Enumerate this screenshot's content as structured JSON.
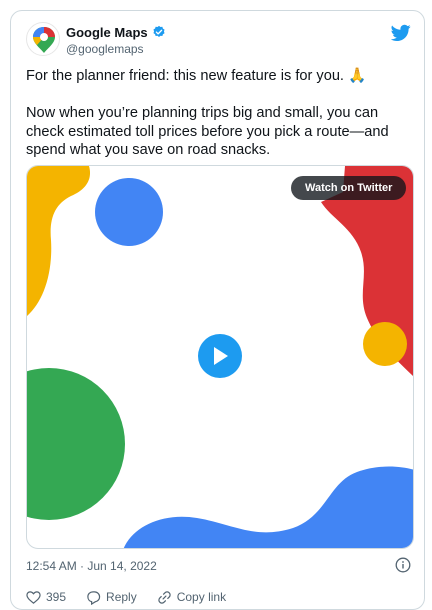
{
  "author": {
    "display_name": "Google Maps",
    "handle": "@googlemaps",
    "verified": true,
    "avatar_icon": "google-maps-pin-icon"
  },
  "tweet": {
    "line1": "For the planner friend: this new feature is for you. 🙏",
    "line2": "Now when you’re planning trips big and small, you can check estimated toll prices before you pick a route—and spend what you save on road snacks."
  },
  "media": {
    "watch_label": "Watch on Twitter",
    "play_icon": "play-icon"
  },
  "footer": {
    "timestamp": "12:54 AM · Jun 14, 2022",
    "info_icon": "info-icon"
  },
  "actions": [
    {
      "icon": "heart-icon",
      "label": "395"
    },
    {
      "icon": "reply-icon",
      "label": "Reply"
    },
    {
      "icon": "link-icon",
      "label": "Copy link"
    }
  ],
  "colors": {
    "blue": "#4285f4",
    "red": "#db3236",
    "yellow": "#f4b400",
    "green": "#34a853",
    "twitter_blue": "#1d9bf0"
  }
}
